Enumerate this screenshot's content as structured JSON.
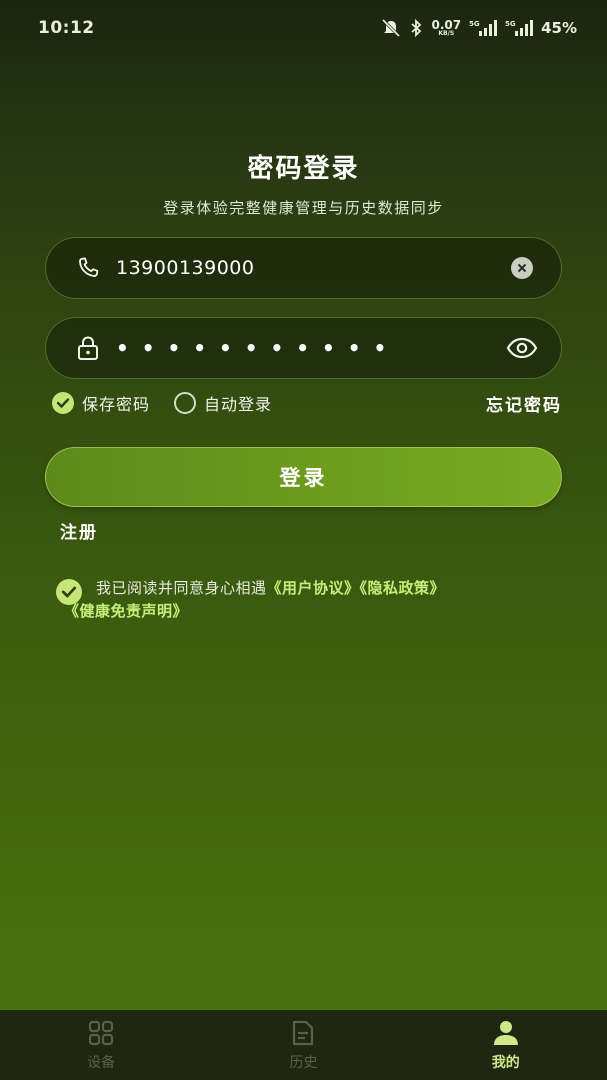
{
  "status_bar": {
    "time": "10:12",
    "net_speed_value": "0.07",
    "net_speed_unit": "KB/S",
    "signal1_label": "5G",
    "signal2_label": "5G",
    "battery": "45%",
    "icons": [
      "mute-icon",
      "bluetooth-icon",
      "signal-icon",
      "signal-icon"
    ]
  },
  "header": {
    "title": "密码登录",
    "subtitle": "登录体验完整健康管理与历史数据同步"
  },
  "form": {
    "phone": {
      "icon": "phone-icon",
      "value": "13900139000",
      "clear_icon": "clear-icon"
    },
    "password": {
      "icon": "lock-icon",
      "value": "• • • • • • • • • • •",
      "toggle_icon": "eye-icon"
    },
    "save_password": {
      "label": "保存密码",
      "checked": true
    },
    "auto_login": {
      "label": "自动登录",
      "checked": false
    },
    "forgot_label": "忘记密码",
    "login_label": "登录",
    "register_label": "注册"
  },
  "agreement": {
    "checked": true,
    "text": "我已阅读并同意身心相遇",
    "link_user": "《用户协议》",
    "link_privacy": "《隐私政策》",
    "link_health": "《健康免责声明》"
  },
  "tab_bar": {
    "tabs": [
      {
        "label": "设备",
        "icon": "grid-icon",
        "active": false
      },
      {
        "label": "历史",
        "icon": "document-icon",
        "active": false
      },
      {
        "label": "我的",
        "icon": "user-icon",
        "active": true
      }
    ]
  },
  "colors": {
    "accent": "#c5e676",
    "link": "#c7ec7a",
    "button": "#6d9c1e",
    "tab_active": "#cfe98a",
    "tab_inactive": "#5a6149"
  }
}
